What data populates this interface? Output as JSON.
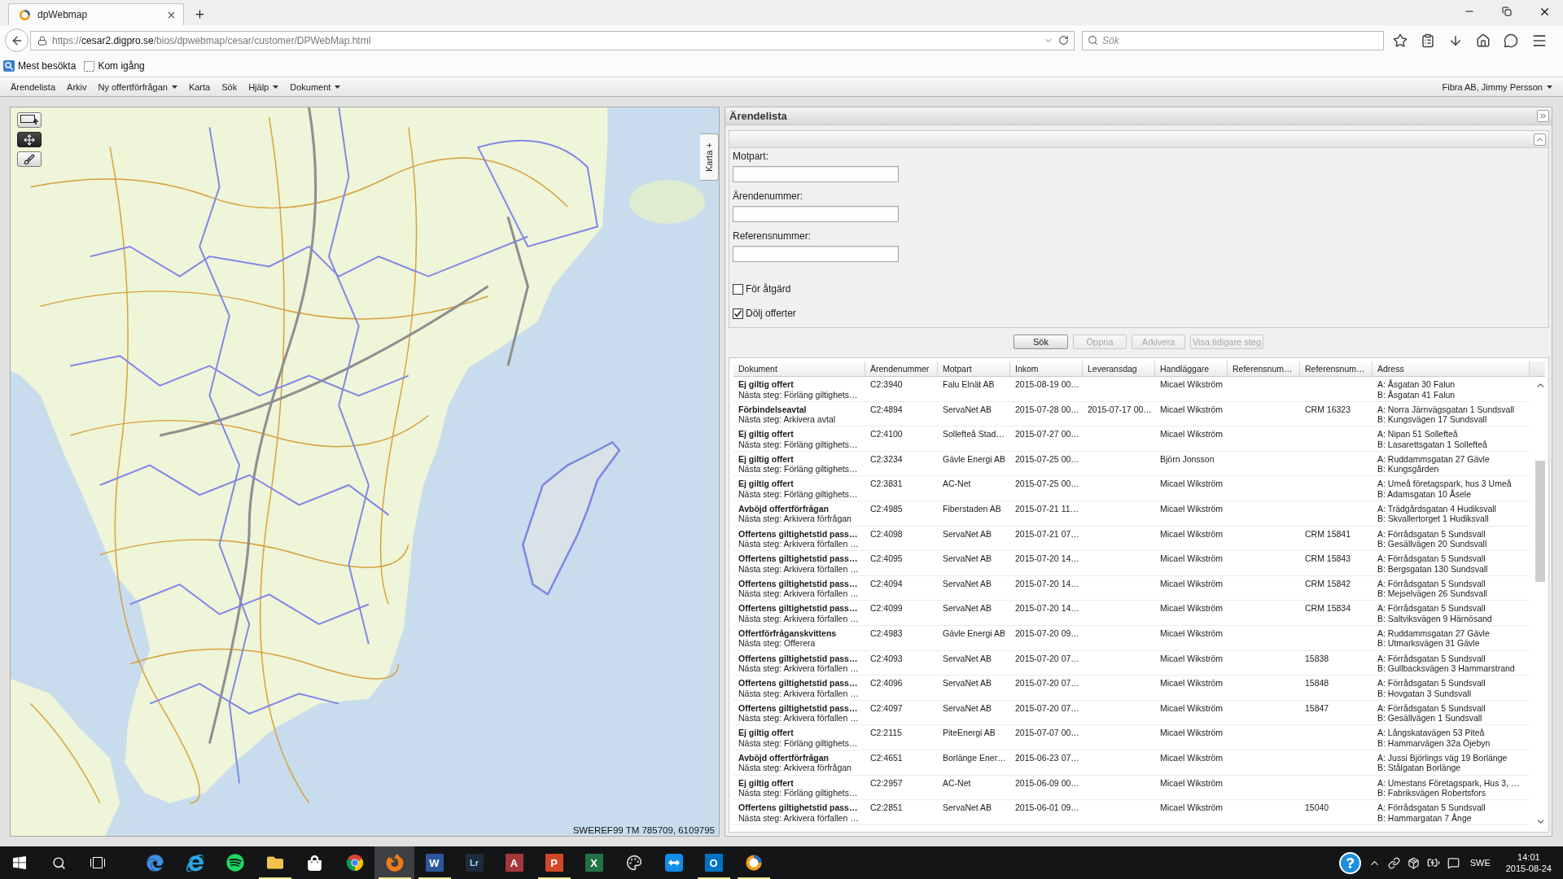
{
  "browser": {
    "tabs": [
      {
        "title": "dpWebmap",
        "selected": true
      }
    ],
    "url": "https://**cesar2.digpro.se**/bios/dpwebmap/cesar/customer/DPWebMap.html",
    "search": {
      "placeholder": "Sök"
    },
    "bookmarks": [
      {
        "kind": "smart",
        "label": "Mest besökta"
      },
      {
        "kind": "page",
        "label": "Kom igång"
      }
    ]
  },
  "menu_bar": {
    "items": [
      {
        "label": "Ärendelista",
        "dropdown": false
      },
      {
        "label": "Arkiv",
        "dropdown": false
      },
      {
        "label": "Ny offertförfrågan",
        "dropdown": true
      },
      {
        "label": "Karta",
        "dropdown": false
      },
      {
        "label": "Sök",
        "dropdown": false
      },
      {
        "label": "Hjälp",
        "dropdown": true
      },
      {
        "label": "Dokument",
        "dropdown": true
      }
    ],
    "user": {
      "label": "Fibra AB, Jimmy Persson",
      "dropdown": true
    }
  },
  "map": {
    "tools": [
      {
        "kind": "zoom-box",
        "selected": false
      },
      {
        "kind": "pan",
        "selected": true
      },
      {
        "kind": "brush",
        "selected": false
      }
    ],
    "side_tab": "Karta +",
    "coordinates": "SWEREF99 TM 785709, 6109795"
  },
  "case_panel": {
    "title": "Ärendelista",
    "fields": [
      {
        "label": "Motpart:"
      },
      {
        "label": "Ärendenummer:"
      },
      {
        "label": "Referensnummer:"
      }
    ],
    "checkboxes": [
      {
        "label": "För åtgärd",
        "checked": false
      },
      {
        "label": "Dölj offerter",
        "checked": true
      }
    ],
    "buttons": [
      {
        "label": "Sök",
        "disabled": false
      },
      {
        "label": "Öppna",
        "disabled": true
      },
      {
        "label": "Arkivera",
        "disabled": true
      },
      {
        "label": "Visa tidigare steg",
        "disabled": true
      }
    ],
    "table": {
      "columns": [
        "Dokument",
        "Ärendenummer",
        "Motpart",
        "Inkom",
        "Leveransdag",
        "Handläggare",
        "Referensnum…",
        "Referensnum…",
        "Adress"
      ],
      "rows": [
        {
          "title": "Ej giltig offert",
          "next_step": "Nästa steg: Förläng giltighets…",
          "case_number": "C2:3940",
          "counterparty": "Falu Elnät AB",
          "received": "2015-08-19 00…",
          "handler": "Micael Wikström",
          "address": [
            "A: Åsgatan 30 Falun",
            "B: Åsgatan 41 Falun"
          ]
        },
        {
          "title": "Förbindelseavtal",
          "next_step": "Nästa steg: Arkivera avtal",
          "case_number": "C2:4894",
          "counterparty": "ServaNet AB",
          "received": "2015-07-28 00…",
          "delivery_date": "2015-07-17 00…",
          "handler": "Micael Wikström",
          "column_8": "CRM 16323",
          "address": [
            "A: Norra Järnvägsgatan 1 Sundsvall",
            "B: Kungsvägen 17 Sundsvall"
          ]
        },
        {
          "title": "Ej giltig offert",
          "next_step": "Nästa steg: Förläng giltighets…",
          "case_number": "C2:4100",
          "counterparty": "Sollefteå Stad…",
          "received": "2015-07-27 00…",
          "handler": "Micael Wikström",
          "address": [
            "A: Nipan 51 Sollefteå",
            "B: Lasarettsgatan 1 Sollefteå"
          ]
        },
        {
          "title": "Ej giltig offert",
          "next_step": "Nästa steg: Förläng giltighets…",
          "case_number": "C2:3234",
          "counterparty": "Gävle Energi AB",
          "received": "2015-07-25 00…",
          "handler": "Björn Jonsson",
          "address": [
            "A: Ruddammsgatan 27 Gävle",
            "B: Kungsgården"
          ]
        },
        {
          "title": "Ej giltig offert",
          "next_step": "Nästa steg: Förläng giltighets…",
          "case_number": "C2:3831",
          "counterparty": "AC-Net",
          "received": "2015-07-25 00…",
          "handler": "Micael Wikström",
          "address": [
            "A: Umeå företagspark, hus 3 Umeå",
            "B: Adamsgatan 10 Åsele"
          ]
        },
        {
          "title": "Avböjd offertförfrågan",
          "next_step": "Nästa steg: Arkivera förfrågan",
          "case_number": "C2:4985",
          "counterparty": "Fiberstaden AB",
          "received": "2015-07-21 11…",
          "handler": "Micael Wikström",
          "address": [
            "A: Trädgårdsgatan 4 Hudiksvall",
            "B: Skvallertorget 1 Hudiksvall"
          ]
        },
        {
          "title": "Offertens giltighetstid pass…",
          "next_step": "Nästa steg: Arkivera förfallen …",
          "case_number": "C2:4098",
          "counterparty": "ServaNet AB",
          "received": "2015-07-21 07…",
          "handler": "Micael Wikström",
          "column_8": "CRM 15841",
          "address": [
            "A: Förrådsgatan 5 Sundsvall",
            "B: Gesällvägen 20 Sundsvall"
          ]
        },
        {
          "title": "Offertens giltighetstid pass…",
          "next_step": "Nästa steg: Arkivera förfallen …",
          "case_number": "C2:4095",
          "counterparty": "ServaNet AB",
          "received": "2015-07-20 14…",
          "handler": "Micael Wikström",
          "column_8": "CRM 15843",
          "address": [
            "A: Förrådsgatan 5 Sundsvall",
            "B: Bergsgatan 130 Sundsvall"
          ]
        },
        {
          "title": "Offertens giltighetstid pass…",
          "next_step": "Nästa steg: Arkivera förfallen …",
          "case_number": "C2:4094",
          "counterparty": "ServaNet AB",
          "received": "2015-07-20 14…",
          "handler": "Micael Wikström",
          "column_8": "CRM 15842",
          "address": [
            "A: Förrådsgatan 5 Sundsvall",
            "B: Mejselvägen 26 Sundsvall"
          ]
        },
        {
          "title": "Offertens giltighetstid pass…",
          "next_step": "Nästa steg: Arkivera förfallen …",
          "case_number": "C2:4099",
          "counterparty": "ServaNet AB",
          "received": "2015-07-20 14…",
          "handler": "Micael Wikström",
          "column_8": "CRM 15834",
          "address": [
            "A: Förrådsgatan 5 Sundsvall",
            "B: Saltviksvägen 9 Härnösand"
          ]
        },
        {
          "title": "Offertförfråganskvittens",
          "next_step": "Nästa steg: Offerera",
          "case_number": "C2:4983",
          "counterparty": "Gävle Energi AB",
          "received": "2015-07-20 09…",
          "handler": "Micael Wikström",
          "address": [
            "A: Ruddammsgatan 27 Gävle",
            "B: Utmarksvägen 31 Gävle"
          ]
        },
        {
          "title": "Offertens giltighetstid pass…",
          "next_step": "Nästa steg: Arkivera förfallen …",
          "case_number": "C2:4093",
          "counterparty": "ServaNet AB",
          "received": "2015-07-20 07…",
          "handler": "Micael Wikström",
          "column_8": "15838",
          "address": [
            "A: Förrådsgatan 5 Sundsvall",
            "B: Gullbacksvägen 3 Hammarstrand"
          ]
        },
        {
          "title": "Offertens giltighetstid pass…",
          "next_step": "Nästa steg: Arkivera förfallen …",
          "case_number": "C2:4096",
          "counterparty": "ServaNet AB",
          "received": "2015-07-20 07…",
          "handler": "Micael Wikström",
          "column_8": "15848",
          "address": [
            "A: Förrådsgatan 5 Sundsvall",
            "B: Hovgatan 3 Sundsvall"
          ]
        },
        {
          "title": "Offertens giltighetstid pass…",
          "next_step": "Nästa steg: Arkivera förfallen …",
          "case_number": "C2:4097",
          "counterparty": "ServaNet AB",
          "received": "2015-07-20 07…",
          "handler": "Micael Wikström",
          "column_8": "15847",
          "address": [
            "A: Förrådsgatan 5 Sundsvall",
            "B: Gesällvägen 1 Sundsvall"
          ]
        },
        {
          "title": "Ej giltig offert",
          "next_step": "Nästa steg: Förläng giltighets…",
          "case_number": "C2:2115",
          "counterparty": "PiteEnergi AB",
          "received": "2015-07-07 00…",
          "handler": "Micael Wikström",
          "address": [
            "A: Långskatavägen 53 Piteå",
            "B: Hammarvägen 32a Öjebyn"
          ]
        },
        {
          "title": "Avböjd offertförfrågan",
          "next_step": "Nästa steg: Arkivera förfrågan",
          "case_number": "C2:4651",
          "counterparty": "Borlänge Ener…",
          "received": "2015-06-23 07…",
          "handler": "Micael Wikström",
          "address": [
            "A: Jussi Björlings väg 19 Borlänge",
            "B: Stålgatan Borlänge"
          ]
        },
        {
          "title": "Ej giltig offert",
          "next_step": "Nästa steg: Förläng giltighets…",
          "case_number": "C2:2957",
          "counterparty": "AC-Net",
          "received": "2015-06-09 00…",
          "handler": "Micael Wikström",
          "address": [
            "A: Umestans Företagspark, Hus 3, …",
            "B: Fabriksvägen Robertsfors"
          ]
        },
        {
          "title": "Offertens giltighetstid pass…",
          "next_step": "Nästa steg: Arkivera förfallen …",
          "case_number": "C2:2851",
          "counterparty": "ServaNet AB",
          "received": "2015-06-01 09…",
          "handler": "Micael Wikström",
          "column_8": "15040",
          "address": [
            "A: Förrådsgatan 5 Sundsvall",
            "B: Hammargatan 7 Ånge"
          ]
        }
      ]
    }
  },
  "taskbar": {
    "apps": [
      {
        "kind": "edge",
        "running": false,
        "selected": false
      },
      {
        "kind": "ie",
        "running": false,
        "selected": false
      },
      {
        "kind": "spotify",
        "running": false,
        "selected": false
      },
      {
        "kind": "folder",
        "running": true,
        "selected": false
      },
      {
        "kind": "store",
        "running": false,
        "selected": false
      },
      {
        "kind": "chrome",
        "running": false,
        "selected": false
      },
      {
        "kind": "firefox",
        "running": true,
        "selected": true
      },
      {
        "kind": "tile",
        "letter": "W",
        "color": "#2b579a",
        "running": true,
        "selected": false
      },
      {
        "kind": "tile",
        "letter": "Lr",
        "color": "#1d2b3c",
        "running": false,
        "selected": false
      },
      {
        "kind": "tile",
        "letter": "A",
        "color": "#a4373a",
        "running": false,
        "selected": false
      },
      {
        "kind": "tile",
        "letter": "P",
        "color": "#d24726",
        "running": true,
        "selected": false
      },
      {
        "kind": "tile",
        "letter": "X",
        "color": "#217346",
        "running": false,
        "selected": false
      },
      {
        "kind": "palette",
        "running": false,
        "selected": false
      },
      {
        "kind": "arrows",
        "running": false,
        "selected": false
      },
      {
        "kind": "tile",
        "letter": "O",
        "color": "#0072c6",
        "running": true,
        "selected": false
      },
      {
        "kind": "ring",
        "running": true,
        "selected": false
      }
    ],
    "language": "SWE",
    "time": "14:01",
    "date": "2015-08-24"
  }
}
